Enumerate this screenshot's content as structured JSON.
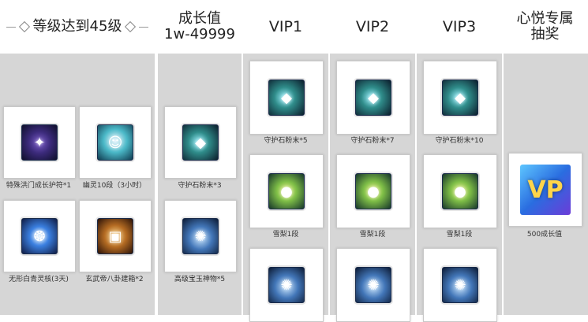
{
  "headers": {
    "level": "等级达到45级",
    "growth_title": "成长值",
    "growth_range": "1w-49999",
    "vip1": "VIP1",
    "vip2": "VIP2",
    "vip3": "VIP3",
    "lottery_line1": "心悦专属",
    "lottery_line2": "抽奖"
  },
  "colors": {
    "column_bg": "#d6d6d6",
    "card_border": "#c9c9c9"
  },
  "items": {
    "level_1": {
      "label": "特殊洪门成长护符*1",
      "icon": "belt-icon"
    },
    "level_2": {
      "label": "幽灵10段（3小时）",
      "icon": "ghost-icon"
    },
    "level_3": {
      "label": "无形白青灵核(3天)",
      "icon": "core-icon"
    },
    "level_4": {
      "label": "玄武帝八卦建箱*2",
      "icon": "chest-icon"
    },
    "growth_1": {
      "label": "守护石粉末*3",
      "icon": "gem-icon"
    },
    "growth_2": {
      "label": "高级宝玉神物*5",
      "icon": "holy-item-icon"
    },
    "vip1_1": {
      "label": "守护石粉末*5",
      "icon": "gem-icon"
    },
    "vip1_2": {
      "label": "雪梨1段",
      "icon": "pear-icon"
    },
    "vip2_1": {
      "label": "守护石粉末*7",
      "icon": "gem-icon"
    },
    "vip2_2": {
      "label": "雪梨1段",
      "icon": "pear-icon"
    },
    "vip3_1": {
      "label": "守护石粉末*10",
      "icon": "gem-icon"
    },
    "vip3_2": {
      "label": "雪梨1段",
      "icon": "pear-icon"
    },
    "lottery_1": {
      "label": "500成长值",
      "icon": "vip-badge-icon"
    }
  }
}
